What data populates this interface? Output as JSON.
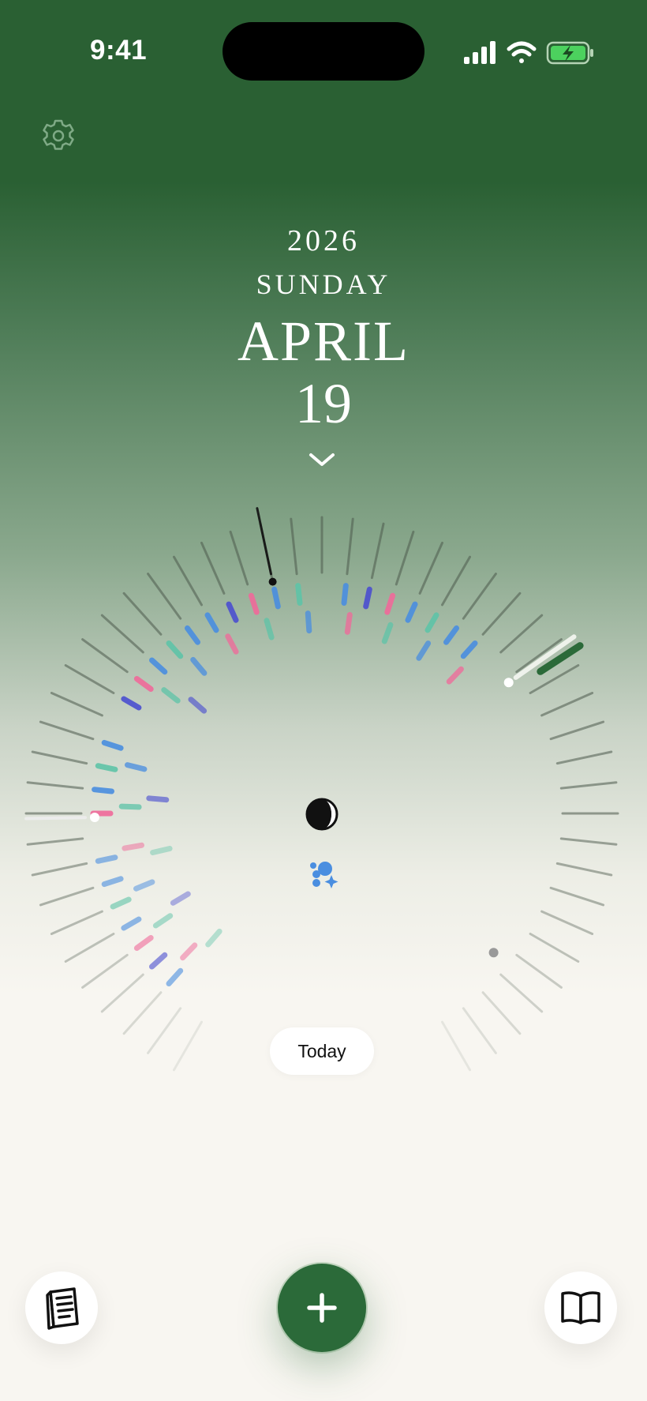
{
  "status_bar": {
    "time": "9:41",
    "icons": [
      "cellular-signal-icon",
      "wifi-icon",
      "battery-charging-icon"
    ]
  },
  "header": {
    "settings_icon": "gear-icon"
  },
  "date": {
    "year": "2026",
    "weekday": "SUNDAY",
    "month": "APRIL",
    "day": "19",
    "expand_icon": "chevron-down-icon"
  },
  "dial": {
    "center_icons": [
      "half-moon-icon",
      "bubbles-sparkle-icon"
    ]
  },
  "today_button": {
    "label": "Today"
  },
  "bottom_bar": {
    "left_icon": "journal-icon",
    "center_icon": "plus-icon",
    "right_icon": "open-book-icon"
  },
  "colors": {
    "header_green": "#2a6033",
    "accent_green": "#2b6a39",
    "background": "#f8f6f1",
    "mark_blue": "#4a8ee0",
    "mark_indigo": "#4b4fd0",
    "mark_pink": "#f06a9a",
    "mark_teal": "#5fc4a8"
  }
}
